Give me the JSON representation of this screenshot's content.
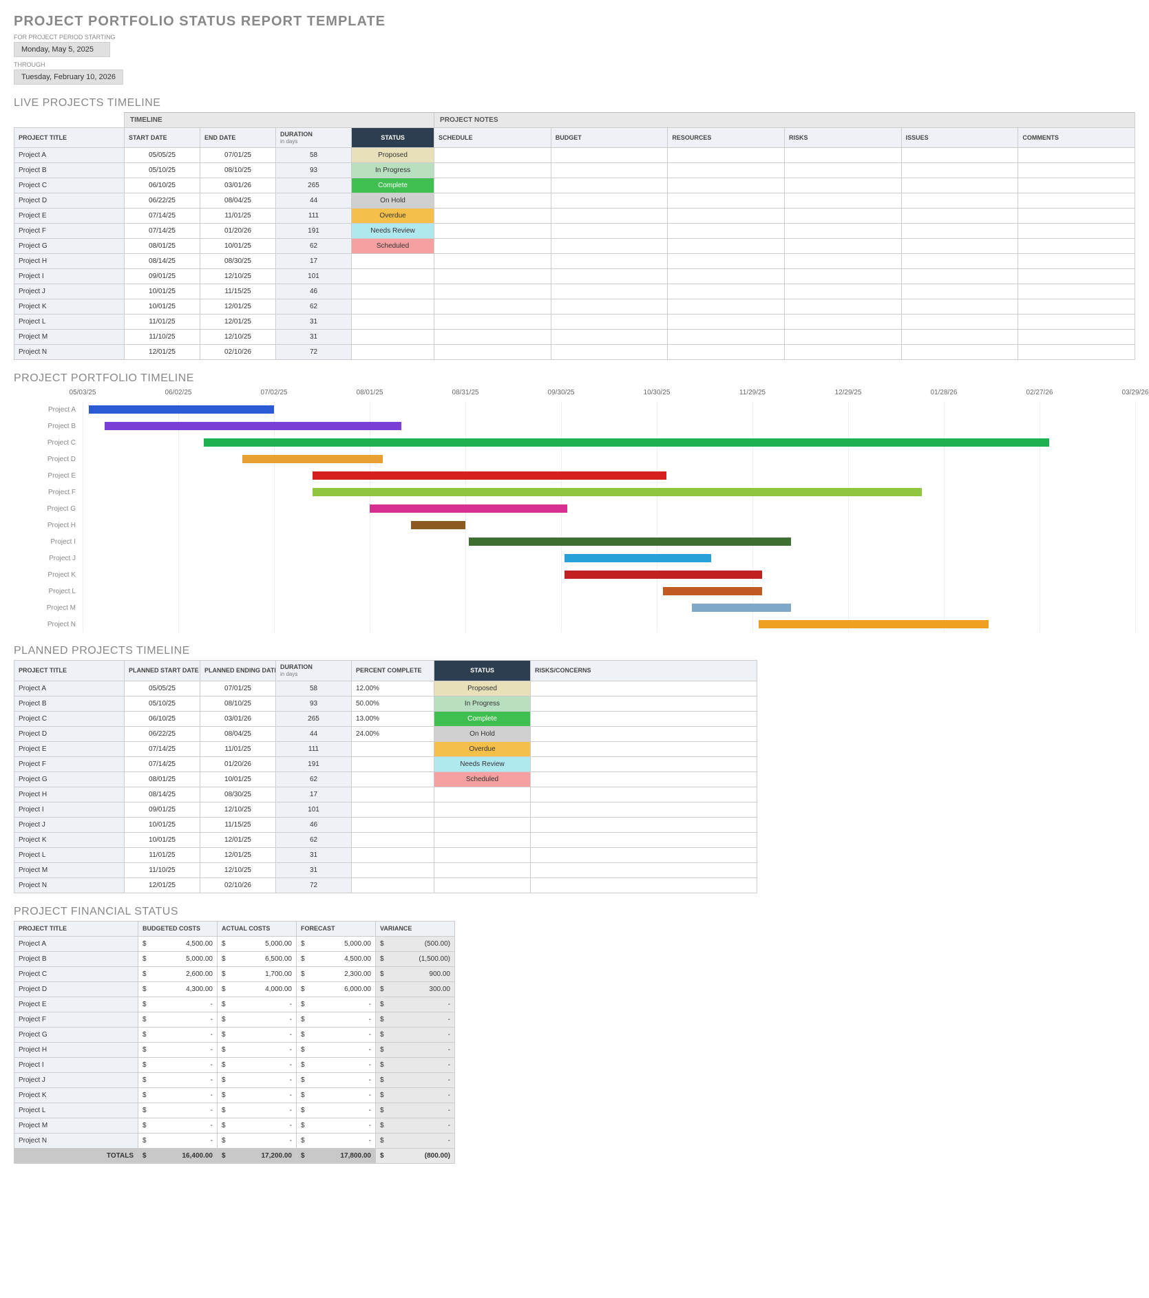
{
  "title": "PROJECT PORTFOLIO STATUS REPORT TEMPLATE",
  "periodStartLabel": "FOR PROJECT PERIOD STARTING",
  "periodStartDate": "Monday, May 5, 2025",
  "throughLabel": "THROUGH",
  "throughDate": "Tuesday, February 10, 2026",
  "liveSection": {
    "title": "LIVE PROJECTS TIMELINE",
    "super": {
      "timeline": "TIMELINE",
      "notes": "PROJECT NOTES"
    },
    "cols": {
      "title": "PROJECT TITLE",
      "start": "START DATE",
      "end": "END DATE",
      "duration": "DURATION",
      "durationSub": "in days",
      "status": "STATUS",
      "schedule": "SCHEDULE",
      "budget": "BUDGET",
      "resources": "RESOURCES",
      "risks": "RISKS",
      "issues": "ISSUES",
      "comments": "COMMENTS"
    },
    "rows": [
      {
        "title": "Project A",
        "start": "05/05/25",
        "end": "07/01/25",
        "duration": "58",
        "status": "Proposed"
      },
      {
        "title": "Project B",
        "start": "05/10/25",
        "end": "08/10/25",
        "duration": "93",
        "status": "In Progress"
      },
      {
        "title": "Project C",
        "start": "06/10/25",
        "end": "03/01/26",
        "duration": "265",
        "status": "Complete"
      },
      {
        "title": "Project D",
        "start": "06/22/25",
        "end": "08/04/25",
        "duration": "44",
        "status": "On Hold"
      },
      {
        "title": "Project E",
        "start": "07/14/25",
        "end": "11/01/25",
        "duration": "111",
        "status": "Overdue"
      },
      {
        "title": "Project F",
        "start": "07/14/25",
        "end": "01/20/26",
        "duration": "191",
        "status": "Needs Review"
      },
      {
        "title": "Project G",
        "start": "08/01/25",
        "end": "10/01/25",
        "duration": "62",
        "status": "Scheduled"
      },
      {
        "title": "Project H",
        "start": "08/14/25",
        "end": "08/30/25",
        "duration": "17",
        "status": ""
      },
      {
        "title": "Project I",
        "start": "09/01/25",
        "end": "12/10/25",
        "duration": "101",
        "status": ""
      },
      {
        "title": "Project J",
        "start": "10/01/25",
        "end": "11/15/25",
        "duration": "46",
        "status": ""
      },
      {
        "title": "Project K",
        "start": "10/01/25",
        "end": "12/01/25",
        "duration": "62",
        "status": ""
      },
      {
        "title": "Project L",
        "start": "11/01/25",
        "end": "12/01/25",
        "duration": "31",
        "status": ""
      },
      {
        "title": "Project M",
        "start": "11/10/25",
        "end": "12/10/25",
        "duration": "31",
        "status": ""
      },
      {
        "title": "Project N",
        "start": "12/01/25",
        "end": "02/10/26",
        "duration": "72",
        "status": ""
      }
    ]
  },
  "chart_data": {
    "type": "gantt",
    "title": "PROJECT PORTFOLIO TIMELINE",
    "x_ticks": [
      "05/03/25",
      "06/02/25",
      "07/02/25",
      "08/01/25",
      "08/31/25",
      "09/30/25",
      "10/30/25",
      "11/29/25",
      "12/29/25",
      "01/28/26",
      "02/27/26",
      "03/29/26"
    ],
    "x_tick_days": [
      0,
      30,
      60,
      90,
      120,
      150,
      180,
      210,
      240,
      270,
      300,
      330
    ],
    "x_range_days": 330,
    "origin": "05/03/25",
    "tasks": [
      {
        "name": "Project A",
        "startDay": 2,
        "durationDays": 58,
        "color": "#2a5bd4"
      },
      {
        "name": "Project B",
        "startDay": 7,
        "durationDays": 93,
        "color": "#7a3fd4"
      },
      {
        "name": "Project C",
        "startDay": 38,
        "durationDays": 265,
        "color": "#1fb04f"
      },
      {
        "name": "Project D",
        "startDay": 50,
        "durationDays": 44,
        "color": "#e8a030"
      },
      {
        "name": "Project E",
        "startDay": 72,
        "durationDays": 111,
        "color": "#d62020"
      },
      {
        "name": "Project F",
        "startDay": 72,
        "durationDays": 191,
        "color": "#8fc63f"
      },
      {
        "name": "Project G",
        "startDay": 90,
        "durationDays": 62,
        "color": "#d63090"
      },
      {
        "name": "Project H",
        "startDay": 103,
        "durationDays": 17,
        "color": "#8a5a20"
      },
      {
        "name": "Project I",
        "startDay": 121,
        "durationDays": 101,
        "color": "#3f6f30"
      },
      {
        "name": "Project J",
        "startDay": 151,
        "durationDays": 46,
        "color": "#2aa0d8"
      },
      {
        "name": "Project K",
        "startDay": 151,
        "durationDays": 62,
        "color": "#c02020"
      },
      {
        "name": "Project L",
        "startDay": 182,
        "durationDays": 31,
        "color": "#c05a20"
      },
      {
        "name": "Project M",
        "startDay": 191,
        "durationDays": 31,
        "color": "#7fa8c8"
      },
      {
        "name": "Project N",
        "startDay": 212,
        "durationDays": 72,
        "color": "#f0a020"
      }
    ]
  },
  "plannedSection": {
    "title": "PLANNED PROJECTS TIMELINE",
    "cols": {
      "title": "PROJECT TITLE",
      "start": "PLANNED START DATE",
      "end": "PLANNED ENDING DATE",
      "duration": "DURATION",
      "durationSub": "in days",
      "percent": "PERCENT COMPLETE",
      "status": "STATUS",
      "risks": "RISKS/CONCERNS"
    },
    "rows": [
      {
        "title": "Project A",
        "start": "05/05/25",
        "end": "07/01/25",
        "duration": "58",
        "percent": "12.00%",
        "status": "Proposed"
      },
      {
        "title": "Project B",
        "start": "05/10/25",
        "end": "08/10/25",
        "duration": "93",
        "percent": "50.00%",
        "status": "In Progress"
      },
      {
        "title": "Project C",
        "start": "06/10/25",
        "end": "03/01/26",
        "duration": "265",
        "percent": "13.00%",
        "status": "Complete"
      },
      {
        "title": "Project D",
        "start": "06/22/25",
        "end": "08/04/25",
        "duration": "44",
        "percent": "24.00%",
        "status": "On Hold"
      },
      {
        "title": "Project E",
        "start": "07/14/25",
        "end": "11/01/25",
        "duration": "111",
        "percent": "",
        "status": "Overdue"
      },
      {
        "title": "Project F",
        "start": "07/14/25",
        "end": "01/20/26",
        "duration": "191",
        "percent": "",
        "status": "Needs Review"
      },
      {
        "title": "Project G",
        "start": "08/01/25",
        "end": "10/01/25",
        "duration": "62",
        "percent": "",
        "status": "Scheduled"
      },
      {
        "title": "Project H",
        "start": "08/14/25",
        "end": "08/30/25",
        "duration": "17",
        "percent": "",
        "status": ""
      },
      {
        "title": "Project I",
        "start": "09/01/25",
        "end": "12/10/25",
        "duration": "101",
        "percent": "",
        "status": ""
      },
      {
        "title": "Project J",
        "start": "10/01/25",
        "end": "11/15/25",
        "duration": "46",
        "percent": "",
        "status": ""
      },
      {
        "title": "Project K",
        "start": "10/01/25",
        "end": "12/01/25",
        "duration": "62",
        "percent": "",
        "status": ""
      },
      {
        "title": "Project L",
        "start": "11/01/25",
        "end": "12/01/25",
        "duration": "31",
        "percent": "",
        "status": ""
      },
      {
        "title": "Project M",
        "start": "11/10/25",
        "end": "12/10/25",
        "duration": "31",
        "percent": "",
        "status": ""
      },
      {
        "title": "Project N",
        "start": "12/01/25",
        "end": "02/10/26",
        "duration": "72",
        "percent": "",
        "status": ""
      }
    ]
  },
  "financialSection": {
    "title": "PROJECT FINANCIAL STATUS",
    "cols": {
      "title": "PROJECT TITLE",
      "budget": "BUDGETED COSTS",
      "actual": "ACTUAL COSTS",
      "forecast": "FORECAST",
      "variance": "VARIANCE"
    },
    "rows": [
      {
        "title": "Project A",
        "budget": "4,500.00",
        "actual": "5,000.00",
        "forecast": "5,000.00",
        "variance": "(500.00)"
      },
      {
        "title": "Project B",
        "budget": "5,000.00",
        "actual": "6,500.00",
        "forecast": "4,500.00",
        "variance": "(1,500.00)"
      },
      {
        "title": "Project C",
        "budget": "2,600.00",
        "actual": "1,700.00",
        "forecast": "2,300.00",
        "variance": "900.00"
      },
      {
        "title": "Project D",
        "budget": "4,300.00",
        "actual": "4,000.00",
        "forecast": "6,000.00",
        "variance": "300.00"
      },
      {
        "title": "Project E",
        "budget": "-",
        "actual": "-",
        "forecast": "-",
        "variance": "-"
      },
      {
        "title": "Project F",
        "budget": "-",
        "actual": "-",
        "forecast": "-",
        "variance": "-"
      },
      {
        "title": "Project G",
        "budget": "-",
        "actual": "-",
        "forecast": "-",
        "variance": "-"
      },
      {
        "title": "Project H",
        "budget": "-",
        "actual": "-",
        "forecast": "-",
        "variance": "-"
      },
      {
        "title": "Project I",
        "budget": "-",
        "actual": "-",
        "forecast": "-",
        "variance": "-"
      },
      {
        "title": "Project J",
        "budget": "-",
        "actual": "-",
        "forecast": "-",
        "variance": "-"
      },
      {
        "title": "Project K",
        "budget": "-",
        "actual": "-",
        "forecast": "-",
        "variance": "-"
      },
      {
        "title": "Project L",
        "budget": "-",
        "actual": "-",
        "forecast": "-",
        "variance": "-"
      },
      {
        "title": "Project M",
        "budget": "-",
        "actual": "-",
        "forecast": "-",
        "variance": "-"
      },
      {
        "title": "Project N",
        "budget": "-",
        "actual": "-",
        "forecast": "-",
        "variance": "-"
      }
    ],
    "totals": {
      "label": "TOTALS",
      "budget": "16,400.00",
      "actual": "17,200.00",
      "forecast": "17,800.00",
      "variance": "(800.00)"
    }
  },
  "statusClassMap": {
    "Proposed": "status-Proposed",
    "In Progress": "status-InProgress",
    "Complete": "status-Complete",
    "On Hold": "status-OnHold",
    "Overdue": "status-Overdue",
    "Needs Review": "status-NeedsReview",
    "Scheduled": "status-Scheduled",
    "": ""
  }
}
